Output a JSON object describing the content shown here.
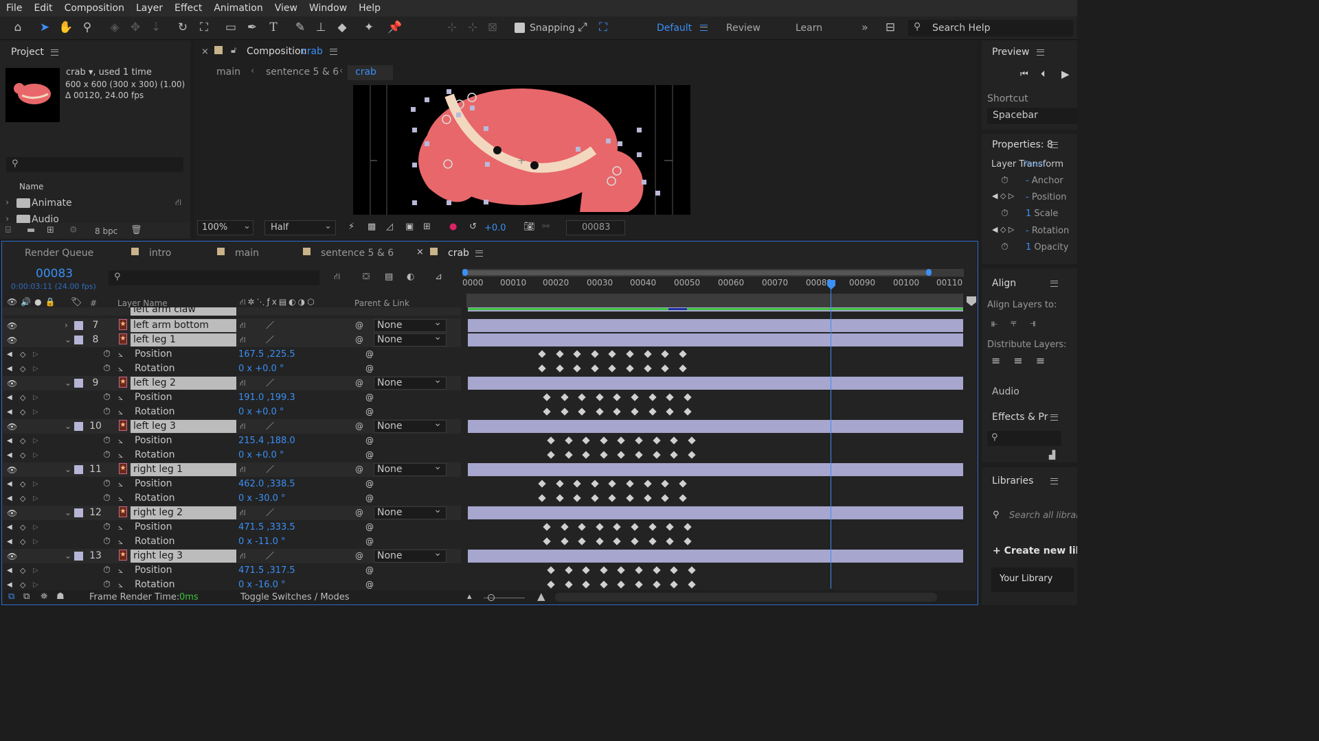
{
  "menu": [
    "File",
    "Edit",
    "Composition",
    "Layer",
    "Effect",
    "Animation",
    "View",
    "Window",
    "Help"
  ],
  "toolbar": {
    "snapping": "Snapping",
    "workspaces": [
      "Default",
      "Review",
      "Learn"
    ],
    "search": "Search Help",
    "more": "»"
  },
  "project": {
    "title": "Project",
    "item_name": "crab",
    "used": ", used 1 time",
    "dims": "600 x 600  (300 x 300) (1.00)",
    "duration": "Δ 00120, 24.00 fps",
    "col_name": "Name",
    "folders": [
      "Animate",
      "Audio"
    ],
    "bpc": "8 bpc"
  },
  "composition": {
    "tab_prefix": "Composition",
    "tab_name": "crab",
    "breadcrumbs": [
      "main",
      "sentence 5 & 6",
      "crab"
    ],
    "zoom": "100%",
    "resolution": "Half",
    "exposure": "+0.0",
    "frame": "00083"
  },
  "preview": {
    "title": "Preview",
    "shortcut_label": "Shortcut",
    "shortcut": "Spacebar"
  },
  "properties": {
    "title": "Properties: 8",
    "group": "Layer Transform",
    "reset": "Reset",
    "items": [
      "Anchor",
      "Position",
      "Scale",
      "Rotation",
      "Opacity"
    ],
    "scale_val": "1",
    "opacity_val": "1"
  },
  "align": {
    "title": "Align",
    "align_to": "Align Layers to:",
    "distribute": "Distribute Layers:"
  },
  "audio": {
    "title": "Audio"
  },
  "effects": {
    "title": "Effects & Presets"
  },
  "libraries": {
    "title": "Libraries",
    "search": "Search all libraries",
    "create": "+ Create new library",
    "your": "Your Library"
  },
  "timeline": {
    "tabs": [
      "Render Queue",
      "intro",
      "main",
      "sentence 5 & 6",
      "crab"
    ],
    "timecode": "00083",
    "subtime": "0:00:03:11 (24.00 fps)",
    "col_layer": "Layer Name",
    "col_parent": "Parent & Link",
    "col_hash": "#",
    "ruler": [
      "0000",
      "00010",
      "00020",
      "00030",
      "00040",
      "00050",
      "00060",
      "00070",
      "00080",
      "00090",
      "00100",
      "00110"
    ],
    "partial_layer": "left arm claw",
    "layers": [
      {
        "num": "7",
        "name": "left arm bottom",
        "parent": "None",
        "props": []
      },
      {
        "num": "8",
        "name": "left leg 1",
        "parent": "None",
        "props": [
          {
            "name": "Position",
            "value": "167.5 ,225.5"
          },
          {
            "name": "Rotation",
            "value": "0 x +0.0 °"
          }
        ]
      },
      {
        "num": "9",
        "name": "left leg 2",
        "parent": "None",
        "props": [
          {
            "name": "Position",
            "value": "191.0 ,199.3"
          },
          {
            "name": "Rotation",
            "value": "0 x +0.0 °"
          }
        ]
      },
      {
        "num": "10",
        "name": "left leg 3",
        "parent": "None",
        "props": [
          {
            "name": "Position",
            "value": "215.4 ,188.0"
          },
          {
            "name": "Rotation",
            "value": "0 x +0.0 °"
          }
        ]
      },
      {
        "num": "11",
        "name": "right leg 1",
        "parent": "None",
        "props": [
          {
            "name": "Position",
            "value": "462.0 ,338.5"
          },
          {
            "name": "Rotation",
            "value": "0 x -30.0 °"
          }
        ]
      },
      {
        "num": "12",
        "name": "right leg 2",
        "parent": "None",
        "props": [
          {
            "name": "Position",
            "value": "471.5 ,333.5"
          },
          {
            "name": "Rotation",
            "value": "0 x -11.0 °"
          }
        ]
      },
      {
        "num": "13",
        "name": "right leg 3",
        "parent": "None",
        "props": [
          {
            "name": "Position",
            "value": "471.5 ,317.5"
          },
          {
            "name": "Rotation",
            "value": "0 x -16.0 °"
          }
        ]
      }
    ],
    "frame_render_label": "Frame Render Time:",
    "frame_render_val": "0ms",
    "toggle": "Toggle Switches / Modes"
  }
}
